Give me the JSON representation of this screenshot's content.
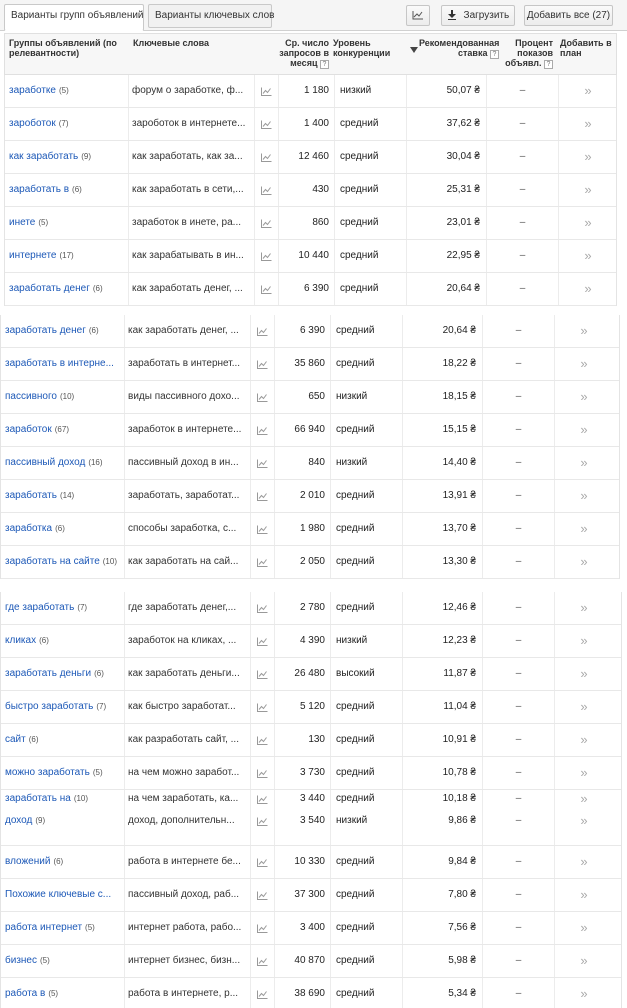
{
  "tabs": {
    "groups": "Варианты групп объявлений",
    "keywords": "Варианты ключевых слов"
  },
  "buttons": {
    "download": "Загрузить",
    "add_all": "Добавить все (27)"
  },
  "headers": {
    "group": "Группы объявлений (по релевантности)",
    "keywords": "Ключевые слова",
    "avg_line1": "Ср. число",
    "avg_line2": "запросов в",
    "avg_line3": "месяц",
    "comp_line1": "Уровень",
    "comp_line2": "конкуренции",
    "bid_line1": "Рекомендованная",
    "bid_line2": "ставка",
    "share_line1": "Процент",
    "share_line2": "показов",
    "share_line3": "объявл.",
    "addplan_line1": "Добавить в",
    "addplan_line2": "план",
    "help": "?"
  },
  "rows": [
    {
      "group": "заработке",
      "count": "(5)",
      "keywords": "форум о заработке, ф...",
      "searches": "1 180",
      "competition": "низкий",
      "bid": "50,07 ₴",
      "share": "–",
      "add": "»"
    },
    {
      "group": "зароботок",
      "count": "(7)",
      "keywords": "зароботок в интернете...",
      "searches": "1 400",
      "competition": "средний",
      "bid": "37,62 ₴",
      "share": "–",
      "add": "»"
    },
    {
      "group": "как заработать",
      "count": "(9)",
      "keywords": "как заработать, как за...",
      "searches": "12 460",
      "competition": "средний",
      "bid": "30,04 ₴",
      "share": "–",
      "add": "»"
    },
    {
      "group": "заработать в",
      "count": "(6)",
      "keywords": "как заработать в сети,...",
      "searches": "430",
      "competition": "средний",
      "bid": "25,31 ₴",
      "share": "–",
      "add": "»"
    },
    {
      "group": "инете",
      "count": "(5)",
      "keywords": "заработок в инете, ра...",
      "searches": "860",
      "competition": "средний",
      "bid": "23,01 ₴",
      "share": "–",
      "add": "»"
    },
    {
      "group": "интернете",
      "count": "(17)",
      "keywords": "как зарабатывать в ин...",
      "searches": "10 440",
      "competition": "средний",
      "bid": "22,95 ₴",
      "share": "–",
      "add": "»"
    },
    {
      "group": "заработать денег",
      "count": "(6)",
      "keywords": "как заработать денег, ...",
      "searches": "6 390",
      "competition": "средний",
      "bid": "20,64 ₴",
      "share": "–",
      "add": "»"
    },
    {
      "group": "заработать денег",
      "count": "(6)",
      "keywords": "как заработать денег, ...",
      "searches": "6 390",
      "competition": "средний",
      "bid": "20,64 ₴",
      "share": "–",
      "add": "»"
    },
    {
      "group": "заработать в интерне...",
      "count": "",
      "keywords": "заработать в интернет...",
      "searches": "35 860",
      "competition": "средний",
      "bid": "18,22 ₴",
      "share": "–",
      "add": "»"
    },
    {
      "group": "пассивного",
      "count": "(10)",
      "keywords": "виды пассивного дохо...",
      "searches": "650",
      "competition": "низкий",
      "bid": "18,15 ₴",
      "share": "–",
      "add": "»"
    },
    {
      "group": "заработок",
      "count": "(67)",
      "keywords": "заработок в интернете...",
      "searches": "66 940",
      "competition": "средний",
      "bid": "15,15 ₴",
      "share": "–",
      "add": "»"
    },
    {
      "group": "пассивный доход",
      "count": "(16)",
      "keywords": "пассивный доход в ин...",
      "searches": "840",
      "competition": "низкий",
      "bid": "14,40 ₴",
      "share": "–",
      "add": "»"
    },
    {
      "group": "заработать",
      "count": "(14)",
      "keywords": "заработать, заработат...",
      "searches": "2 010",
      "competition": "средний",
      "bid": "13,91 ₴",
      "share": "–",
      "add": "»"
    },
    {
      "group": "заработка",
      "count": "(6)",
      "keywords": "способы заработка, с...",
      "searches": "1 980",
      "competition": "средний",
      "bid": "13,70 ₴",
      "share": "–",
      "add": "»"
    },
    {
      "group": "заработать на сайте",
      "count": "(10)",
      "keywords": "как заработать на сай...",
      "searches": "2 050",
      "competition": "средний",
      "bid": "13,30 ₴",
      "share": "–",
      "add": "»"
    },
    {
      "group": "где заработать",
      "count": "(7)",
      "keywords": "где заработать денег,...",
      "searches": "2 780",
      "competition": "средний",
      "bid": "12,46 ₴",
      "share": "–",
      "add": "»"
    },
    {
      "group": "кликах",
      "count": "(6)",
      "keywords": "заработок на кликах, ...",
      "searches": "4 390",
      "competition": "низкий",
      "bid": "12,23 ₴",
      "share": "–",
      "add": "»"
    },
    {
      "group": "заработать деньги",
      "count": "(6)",
      "keywords": "как заработать деньги...",
      "searches": "26 480",
      "competition": "высокий",
      "bid": "11,87 ₴",
      "share": "–",
      "add": "»"
    },
    {
      "group": "быстро заработать",
      "count": "(7)",
      "keywords": "как быстро заработат...",
      "searches": "5 120",
      "competition": "средний",
      "bid": "11,04 ₴",
      "share": "–",
      "add": "»"
    },
    {
      "group": "сайт",
      "count": "(6)",
      "keywords": "как разработать сайт, ...",
      "searches": "130",
      "competition": "средний",
      "bid": "10,91 ₴",
      "share": "–",
      "add": "»"
    },
    {
      "group": "можно заработать",
      "count": "(5)",
      "keywords": "на чем можно заработ...",
      "searches": "3 730",
      "competition": "средний",
      "bid": "10,78 ₴",
      "share": "–",
      "add": "»"
    },
    {
      "group": "заработать на",
      "count": "(10)",
      "keywords": "на чем заработать, ка...",
      "searches": "3 440",
      "competition": "средний",
      "bid": "10,18 ₴",
      "share": "–",
      "add": "»",
      "group2": "доход",
      "count2": "(9)",
      "keywords2": "доход, дополнительн...",
      "searches2": "3 540",
      "competition2": "низкий",
      "bid2": "9,86 ₴",
      "share2": "–",
      "add2": "»"
    },
    {
      "group": "вложений",
      "count": "(6)",
      "keywords": "работа в интернете бе...",
      "searches": "10 330",
      "competition": "средний",
      "bid": "9,84 ₴",
      "share": "–",
      "add": "»"
    },
    {
      "group": "Похожие ключевые с...",
      "count": "",
      "keywords": "пассивный доход, раб...",
      "searches": "37 300",
      "competition": "средний",
      "bid": "7,80 ₴",
      "share": "–",
      "add": "»"
    },
    {
      "group": "работа интернет",
      "count": "(5)",
      "keywords": "интернет работа, рабо...",
      "searches": "3 400",
      "competition": "средний",
      "bid": "7,56 ₴",
      "share": "–",
      "add": "»"
    },
    {
      "group": "бизнес",
      "count": "(5)",
      "keywords": "интернет бизнес, бизн...",
      "searches": "40 870",
      "competition": "средний",
      "bid": "5,98 ₴",
      "share": "–",
      "add": "»"
    },
    {
      "group": "работа в",
      "count": "(5)",
      "keywords": "работа в интернете, р...",
      "searches": "38 690",
      "competition": "средний",
      "bid": "5,34 ₴",
      "share": "–",
      "add": "»"
    }
  ]
}
